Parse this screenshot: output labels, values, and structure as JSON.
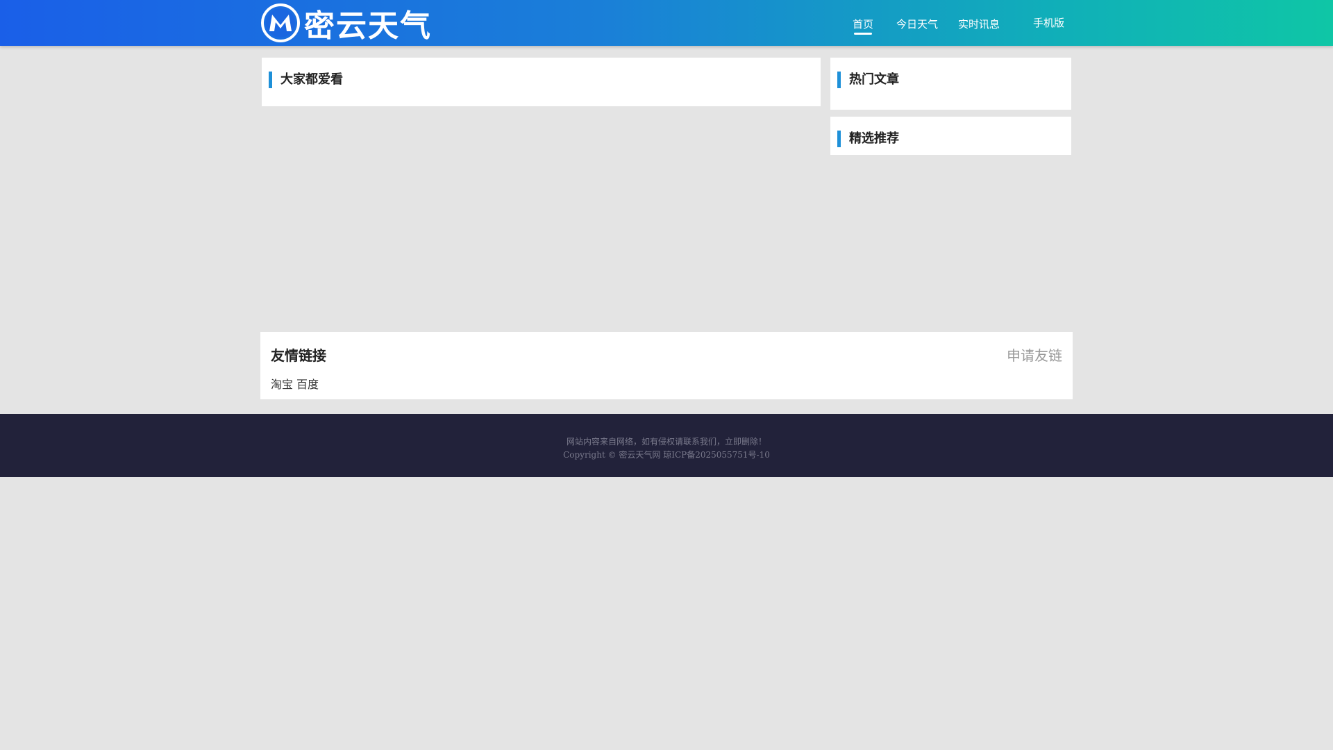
{
  "header": {
    "site_name": "密云天气",
    "nav": [
      "首页",
      "今日天气",
      "实时讯息"
    ],
    "mobile_link": "手机版"
  },
  "main": {
    "popular_section_title": "大家都爱看"
  },
  "sidebar": {
    "hot_articles_title": "热门文章",
    "recommended_title": "精选推荐"
  },
  "friend_links": {
    "title": "友情链接",
    "apply_label": "申请友链",
    "links": [
      "淘宝",
      "百度"
    ]
  },
  "footer": {
    "disclaimer": "网站内容来自网络，如有侵权请联系我们，立即删除！",
    "copyright": "Copyright © 密云天气网 琼ICP备2025055751号-10"
  },
  "colors": {
    "header_gradient_start": "#1a5fe8",
    "header_gradient_end": "#0fc6a6",
    "title_accent": "#1e90d8",
    "footer_bg": "#22223a",
    "page_bg": "#e4e4e4"
  }
}
